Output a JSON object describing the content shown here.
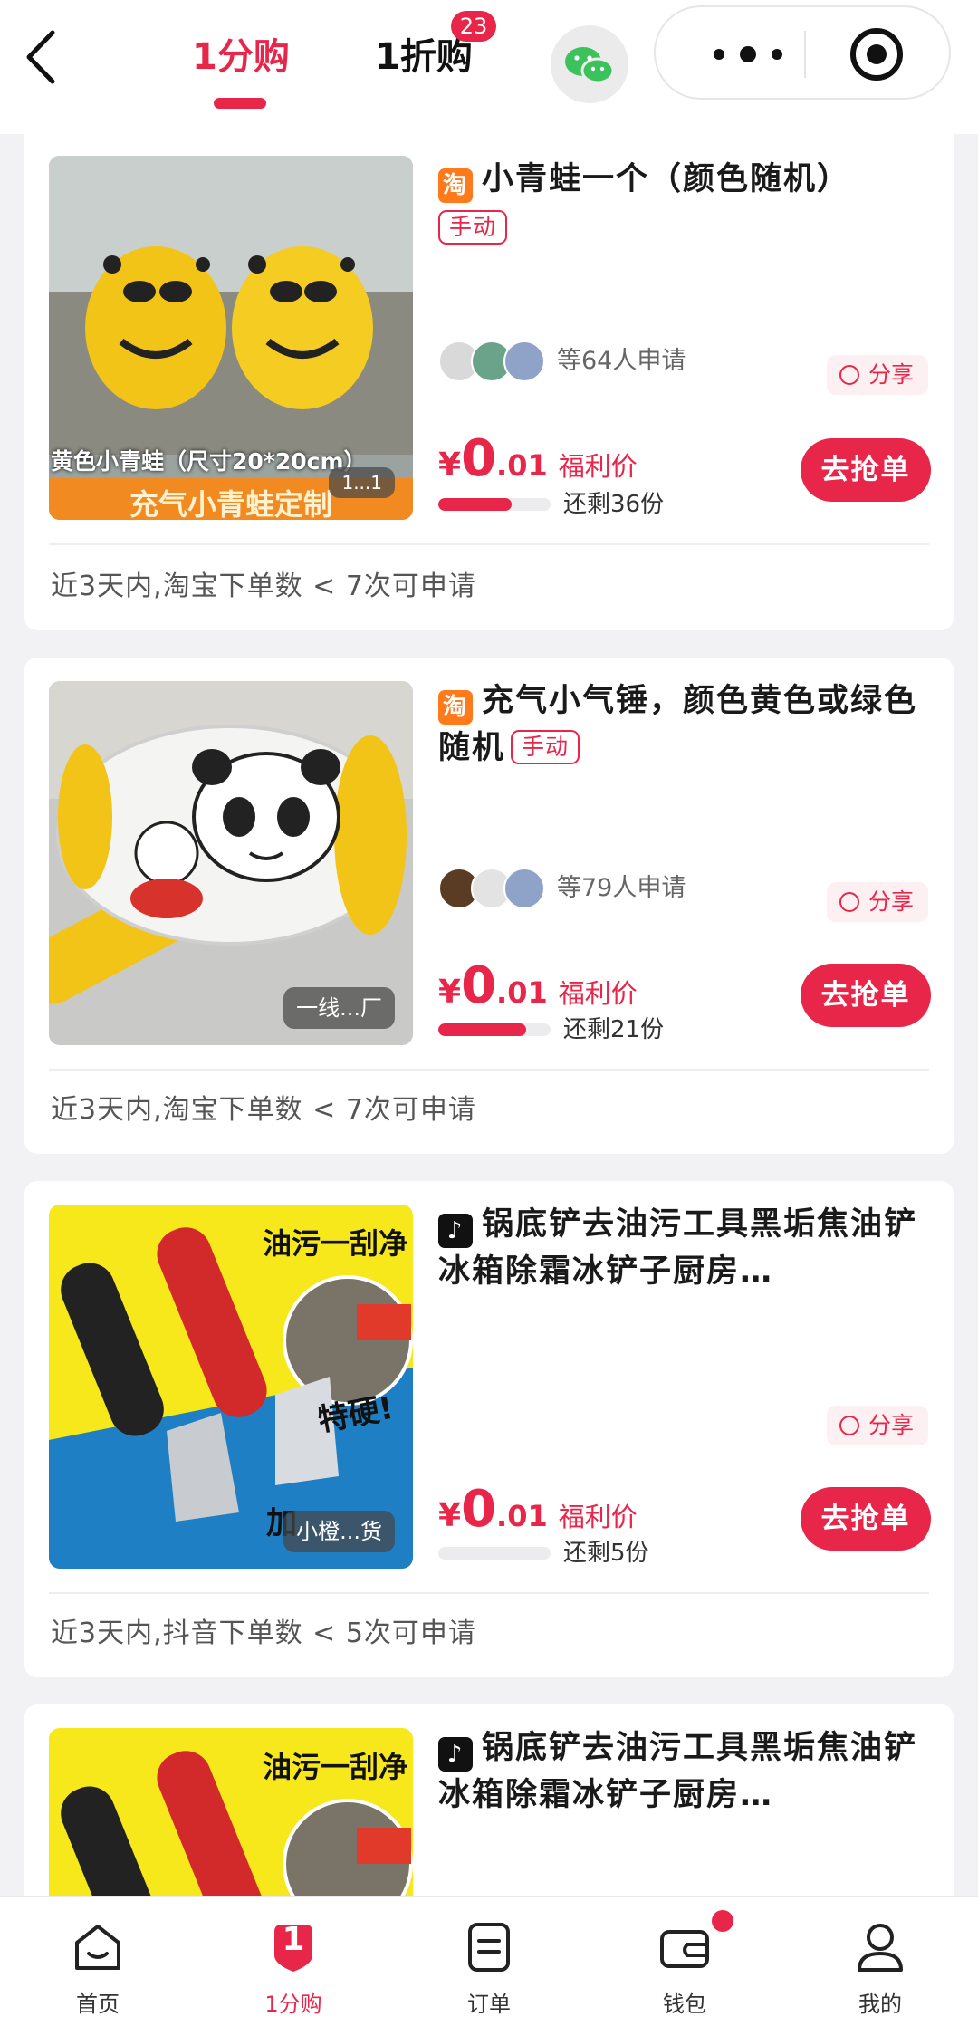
{
  "header": {
    "tabs": [
      {
        "label": "1分购",
        "active": true
      },
      {
        "label": "1折购",
        "badge": "23"
      }
    ],
    "back_icon": "chevron-left-icon",
    "wechat_icon": "wechat-icon",
    "more_icon": "more-dots-icon",
    "close_icon": "target-close-icon"
  },
  "products": [
    {
      "platform": "淘",
      "platform_kind": "taobao",
      "title": "小青蛙一个（颜色随机）",
      "manual_tag": "手动",
      "applicants": "等64人申请",
      "share_label": "分享",
      "price_currency": "¥",
      "price_int": "0",
      "price_dec": ".01",
      "price_label": "福利价",
      "progress": 0.65,
      "remaining": "还剩36份",
      "button": "去抢单",
      "condition": "近3天内,淘宝下单数 < 7次可申请",
      "thumb_caption": "黄色小青蛙（尺寸20*20cm）",
      "thumb_banner": "充气小青蛙定制",
      "thumb_tag": "1...1"
    },
    {
      "platform": "淘",
      "platform_kind": "taobao",
      "title": "充气小气锤，颜色黄色或绿色随机",
      "manual_tag": "手动",
      "applicants": "等79人申请",
      "share_label": "分享",
      "price_currency": "¥",
      "price_int": "0",
      "price_dec": ".01",
      "price_label": "福利价",
      "progress": 0.78,
      "remaining": "还剩21份",
      "button": "去抢单",
      "condition": "近3天内,淘宝下单数 < 7次可申请",
      "thumb_tag": "一线...厂"
    },
    {
      "platform": "♪",
      "platform_kind": "douyin",
      "title": "锅底铲去油污工具黑垢焦油铲冰箱除霜冰铲子厨房…",
      "share_label": "分享",
      "price_currency": "¥",
      "price_int": "0",
      "price_dec": ".01",
      "price_label": "福利价",
      "progress": 0.0,
      "remaining": "还剩5份",
      "button": "去抢单",
      "condition": "近3天内,抖音下单数 < 5次可申请",
      "thumb_text_top": "油污一刮净",
      "thumb_text_mid": "特硬!",
      "thumb_text_bottom": "加",
      "thumb_tag": "小橙...货"
    },
    {
      "platform": "♪",
      "platform_kind": "douyin",
      "title": "锅底铲去油污工具黑垢焦油铲冰箱除霜冰铲子厨房…",
      "thumb_text_top": "油污一刮净"
    }
  ],
  "bottom_nav": [
    {
      "label": "首页",
      "icon": "home-icon",
      "active": false
    },
    {
      "label": "1分购",
      "icon": "one-cent-icon",
      "icon_text": "1",
      "active": true
    },
    {
      "label": "订单",
      "icon": "order-icon",
      "active": false
    },
    {
      "label": "钱包",
      "icon": "wallet-icon",
      "active": false,
      "dot": true
    },
    {
      "label": "我的",
      "icon": "profile-icon",
      "active": false
    }
  ],
  "colors": {
    "accent": "#e8264a",
    "taobao": "#ff7a1a",
    "douyin": "#111111",
    "background": "#f2f2f4"
  }
}
